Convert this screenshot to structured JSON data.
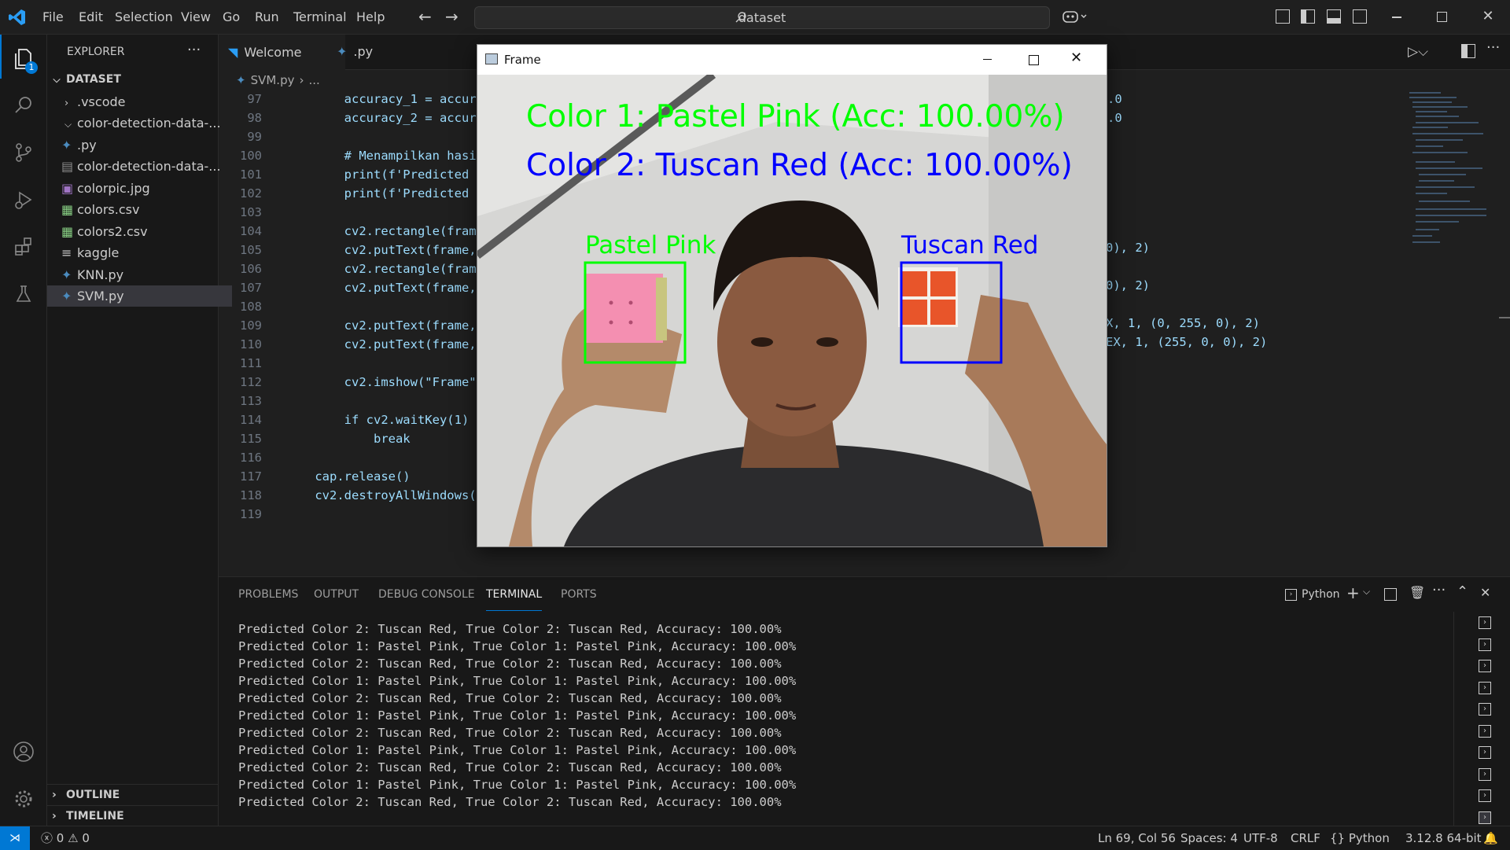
{
  "menu": [
    "File",
    "Edit",
    "Selection",
    "View",
    "Go",
    "Run",
    "Terminal",
    "Help"
  ],
  "search": {
    "text": "dataset"
  },
  "activity": {
    "badge": "1"
  },
  "explorer": {
    "title": "EXPLORER",
    "root": "DATASET",
    "items": [
      {
        "label": ".vscode",
        "icon": "chevron-right"
      },
      {
        "label": "color-detection-data-...",
        "icon": "chevron-down"
      },
      {
        "label": ".py",
        "icon": "python-icon"
      },
      {
        "label": "color-detection-data-...",
        "icon": "file-icon"
      },
      {
        "label": "colorpic.jpg",
        "icon": "image-icon"
      },
      {
        "label": "colors.csv",
        "icon": "csv-icon"
      },
      {
        "label": "colors2.csv",
        "icon": "csv-icon"
      },
      {
        "label": "kaggle",
        "icon": "text-file-icon"
      },
      {
        "label": "KNN.py",
        "icon": "python-icon"
      },
      {
        "label": "SVM.py",
        "icon": "python-icon"
      }
    ],
    "outline": "OUTLINE",
    "timeline": "TIMELINE"
  },
  "tabs": {
    "welcome": "Welcome",
    "py": ".py"
  },
  "breadcrumb": {
    "file": "SVM.py",
    "rest": "..."
  },
  "code": {
    "line_numbers": [
      "97",
      "98",
      "99",
      "100",
      "101",
      "102",
      "103",
      "104",
      "105",
      "106",
      "107",
      "108",
      "109",
      "110",
      "111",
      "112",
      "113",
      "114",
      "115",
      "116",
      "117",
      "118",
      "119"
    ],
    "lines": [
      "        accuracy_1 = accuracy",
      "        accuracy_2 = accuracy",
      "",
      "        # Menampilkan hasil p",
      "        print(f'Predicted Col",
      "        print(f'Predicted Col",
      "",
      "        cv2.rectangle(frame, ",
      "        cv2.putText(frame, f'",
      "        cv2.rectangle(frame, ",
      "        cv2.putText(frame, f'",
      "",
      "        cv2.putText(frame, f'",
      "        cv2.putText(frame, f'",
      "",
      "        cv2.imshow(\"Frame\", f",
      "",
      "        if cv2.waitKey(1) & 0",
      "            break",
      "",
      "    cap.release()",
      "    cv2.destroyAllWindows()",
      ""
    ],
    "right_fragments": {
      "r97": ".0",
      "r98": ".0",
      "r105": "0), 2)",
      "r107": "0), 2)",
      "r109": "X, 1, (0, 255, 0), 2)",
      "r110": "EX, 1, (255, 0, 0), 2)"
    }
  },
  "panel": {
    "tabs": [
      "PROBLEMS",
      "OUTPUT",
      "DEBUG CONSOLE",
      "TERMINAL",
      "PORTS"
    ],
    "active_tab": "TERMINAL",
    "shell": "Python",
    "terminal_lines": [
      "Predicted Color 2: Tuscan Red, True Color 2: Tuscan Red, Accuracy: 100.00%",
      "Predicted Color 1: Pastel Pink, True Color 1: Pastel Pink, Accuracy: 100.00%",
      "Predicted Color 2: Tuscan Red, True Color 2: Tuscan Red, Accuracy: 100.00%",
      "Predicted Color 1: Pastel Pink, True Color 1: Pastel Pink, Accuracy: 100.00%",
      "Predicted Color 2: Tuscan Red, True Color 2: Tuscan Red, Accuracy: 100.00%",
      "Predicted Color 1: Pastel Pink, True Color 1: Pastel Pink, Accuracy: 100.00%",
      "Predicted Color 2: Tuscan Red, True Color 2: Tuscan Red, Accuracy: 100.00%",
      "Predicted Color 1: Pastel Pink, True Color 1: Pastel Pink, Accuracy: 100.00%",
      "Predicted Color 2: Tuscan Red, True Color 2: Tuscan Red, Accuracy: 100.00%",
      "Predicted Color 1: Pastel Pink, True Color 1: Pastel Pink, Accuracy: 100.00%",
      "Predicted Color 2: Tuscan Red, True Color 2: Tuscan Red, Accuracy: 100.00%"
    ]
  },
  "status": {
    "errors": "0",
    "warnings": "0",
    "position": "Ln 69, Col 56",
    "spaces": "Spaces: 4",
    "encoding": "UTF-8",
    "eol": "CRLF",
    "language": "Python",
    "interpreter": "3.12.8 64-bit"
  },
  "frame_window": {
    "title": "Frame",
    "overlay_1": "Color 1: Pastel Pink (Acc: 100.00%)",
    "overlay_2": "Color 2: Tuscan Red (Acc: 100.00%)",
    "box1_label": "Pastel Pink",
    "box2_label": "Tuscan Red",
    "color_green": "#00ff00",
    "color_blue": "#0000ff",
    "cube1_color": "#f48fb1",
    "cube2_color": "#e8552a"
  },
  "colors": {
    "accent": "#0078d4",
    "bg_editor": "#1f1f1f",
    "bg_side": "#181818"
  }
}
